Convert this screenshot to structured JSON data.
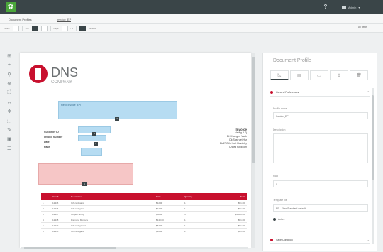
{
  "app": {
    "help_label": "?",
    "user_label": "Admin"
  },
  "breadcrumb": {
    "items": [
      "Document Profiles",
      "Invoice_EP"
    ]
  },
  "toolbar": {
    "page_label": "Page",
    "page_value": "1",
    "page_total": "/ 1",
    "zoom_label": "100",
    "action_label": "All fields",
    "scale_label": "Scale"
  },
  "document": {
    "company_main": "DNS",
    "company_sub": "COMPANY",
    "invoice_field": "Field: Invoice_EPI",
    "markers": [
      "2",
      "3",
      "4",
      "5"
    ],
    "labels": [
      "Customer ID",
      "Invoice Number",
      "Date",
      "Page"
    ],
    "supplier": {
      "heading": "Invoice",
      "lines": [
        "Vadlig 5 Ej",
        "DK-Hamgeri Vaeb",
        "Dk Sastruet Hsr",
        "Dk47 Gth. Hurt Hovdeby",
        "United Kingdom"
      ]
    },
    "table": {
      "headers": [
        "",
        "Item #",
        "Description",
        "Price",
        "Quantity",
        "Total"
      ],
      "rows": [
        [
          "1",
          "12345",
          "Gift cardigans",
          "$12.00",
          "1",
          "$91.00"
        ],
        [
          "2",
          "12346",
          "Gift cardigans",
          "$12.00",
          "1",
          "$91.00"
        ],
        [
          "3",
          "12347",
          "Corpus Shrug",
          "$58.00",
          "5",
          "$1,060.00"
        ],
        [
          "4",
          "12348",
          "Diamond Monocle",
          "$143.00",
          "1",
          "$91.00"
        ],
        [
          "5",
          "12349",
          "Gift cardigans A",
          "$52.00",
          "1",
          "$91.00"
        ],
        [
          "6",
          "12350",
          "Gift cardigans",
          "$12.00",
          "1",
          "$91.00"
        ]
      ]
    }
  },
  "panel": {
    "title": "Document Profile",
    "section1": "General Preferences",
    "profile_name_label": "Profile name",
    "profile_name_value": "Invoice_EP",
    "description_label": "Description",
    "flag_label": "Flag",
    "flag_value": "0",
    "template_label": "Template file",
    "template_value": "EP - Flow Standard default",
    "active_label": "Active",
    "section2": "Save Condition"
  },
  "colors": {
    "topbar": "#3a4548",
    "brand_green": "#4aa63a",
    "accent_red": "#c8102e",
    "highlight_blue": "#b6dcf2",
    "highlight_pink": "#f6c6c6"
  }
}
